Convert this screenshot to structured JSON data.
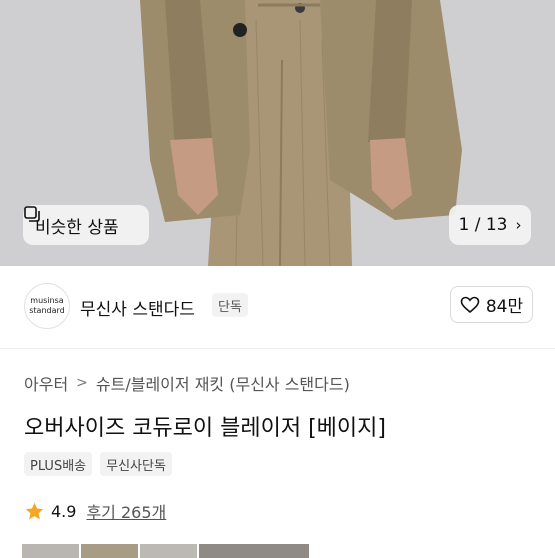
{
  "hero": {
    "similar_label": "비슷한 상품",
    "page_indicator": "1 / 13",
    "icons": {
      "similar": "similar-items-icon",
      "next": "chevron-right-icon"
    }
  },
  "brand": {
    "logo_line1": "musinsa",
    "logo_line2": "standard",
    "name": "무신사 스탠다드",
    "tag": "단독",
    "like_count": "84만"
  },
  "breadcrumb": {
    "level1": "아우터",
    "level2": "슈트/블레이저 재킷 (무신사 스탠다드)"
  },
  "product": {
    "title": "오버사이즈 코듀로이 블레이저 [베이지]",
    "tags": [
      "PLUS배송",
      "무신사단독"
    ],
    "rating": "4.9",
    "reviews": "후기 265개"
  },
  "colors": {
    "star": "#f5a623",
    "jacket": "#9d8c6c",
    "background": "#cfcfd1"
  }
}
